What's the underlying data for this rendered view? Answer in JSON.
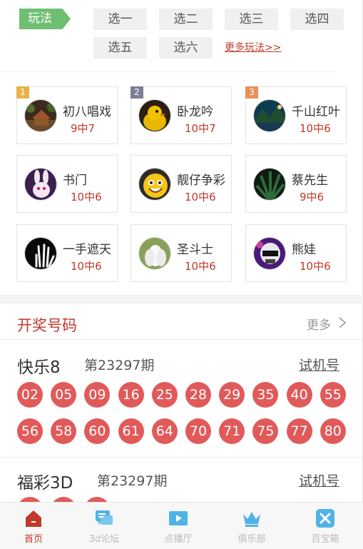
{
  "play": {
    "tag": "玩法",
    "options": [
      "选一",
      "选二",
      "选三",
      "选四",
      "选五",
      "选六"
    ],
    "more": "更多玩法>>"
  },
  "experts": [
    {
      "rank": "1",
      "rank_color": "#e8b24a",
      "name": "初八唱戏",
      "record": "9中7"
    },
    {
      "rank": "2",
      "rank_color": "#7c7d99",
      "name": "卧龙吟",
      "record": "10中7"
    },
    {
      "rank": "3",
      "rank_color": "#e8905a",
      "name": "千山红叶",
      "record": "10中6"
    },
    {
      "rank": "",
      "name": "书门",
      "record": "10中6"
    },
    {
      "rank": "",
      "name": "靓仔争彩",
      "record": "10中6"
    },
    {
      "rank": "",
      "name": "蔡先生",
      "record": "9中6"
    },
    {
      "rank": "",
      "name": "一手遮天",
      "record": "10中6"
    },
    {
      "rank": "",
      "name": "圣斗士",
      "record": "10中6"
    },
    {
      "rank": "",
      "name": "熊娃",
      "record": "10中6"
    }
  ],
  "draw": {
    "title": "开奖号码",
    "more": "更多",
    "games": [
      {
        "name": "快乐8",
        "issue": "第23297期",
        "test": "试机号",
        "numbers": [
          "02",
          "05",
          "09",
          "16",
          "25",
          "28",
          "29",
          "35",
          "40",
          "55",
          "56",
          "58",
          "60",
          "61",
          "64",
          "70",
          "71",
          "75",
          "77",
          "80"
        ]
      },
      {
        "name": "福彩3D",
        "issue": "第23297期",
        "test": "试机号"
      }
    ]
  },
  "nav": {
    "items": [
      {
        "label": "首页",
        "icon": "home-icon",
        "active": true
      },
      {
        "label": "3d论坛",
        "icon": "forum-icon",
        "active": false
      },
      {
        "label": "点播厅",
        "icon": "video-icon",
        "active": false
      },
      {
        "label": "俱乐部",
        "icon": "crown-icon",
        "active": false
      },
      {
        "label": "百宝箱",
        "icon": "toolbox-icon",
        "active": false
      }
    ]
  },
  "colors": {
    "accent_red": "#c0392b",
    "ball_red": "#e15a5a",
    "tag_green": "#6fbf73",
    "icon_blue": "#4fb3e6"
  }
}
